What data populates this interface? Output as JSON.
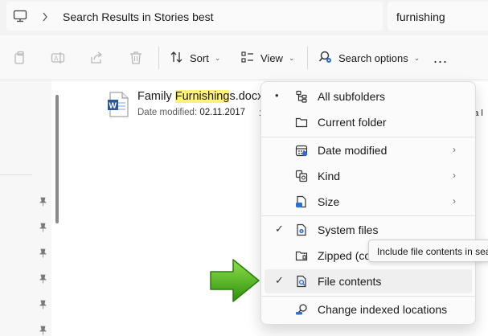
{
  "address": {
    "breadcrumb": "Search Results in Stories best",
    "search_value": "furnishing",
    "icons": {
      "location": "computer-icon",
      "separator": "chevron-right-icon"
    }
  },
  "toolbar": {
    "icons": [
      "copy-icon",
      "rename-icon",
      "share-icon",
      "delete-icon"
    ],
    "sort_label": "Sort",
    "view_label": "View",
    "search_options_label": "Search options",
    "more_label": "..."
  },
  "file": {
    "name_pre": "Family ",
    "name_highlight": "Furnishing",
    "name_post": "s.docx",
    "meta_label": "Date modified:",
    "meta_value": "02.11.2017",
    "peek_mid": "1",
    "peek_right_1": "3",
    "peek_right_2": "ena l",
    "highlight_color": "#fff27a"
  },
  "menu": {
    "items": [
      {
        "label": "All subfolders",
        "icon": "subfolders-icon",
        "mark": "•"
      },
      {
        "label": "Current folder",
        "icon": "folder-icon",
        "mark": ""
      },
      {
        "label": "Date modified",
        "icon": "calendar-icon",
        "mark": "",
        "submenu": "›"
      },
      {
        "label": "Kind",
        "icon": "kind-icon",
        "mark": "",
        "submenu": "›"
      },
      {
        "label": "Size",
        "icon": "size-icon",
        "mark": "",
        "submenu": "›"
      },
      {
        "label": "System files",
        "icon": "system-file-icon",
        "mark": "✓"
      },
      {
        "label": "Zipped (co",
        "icon": "zip-folder-icon",
        "mark": ""
      },
      {
        "label": "File contents",
        "icon": "file-contents-icon",
        "mark": "✓"
      },
      {
        "label": "Change indexed locations",
        "icon": "indexed-locations-icon",
        "mark": ""
      }
    ]
  },
  "tooltip": {
    "text": "Include file contents in sea"
  },
  "colors": {
    "arrow": "#3fa014",
    "accent": "#0067c0"
  }
}
